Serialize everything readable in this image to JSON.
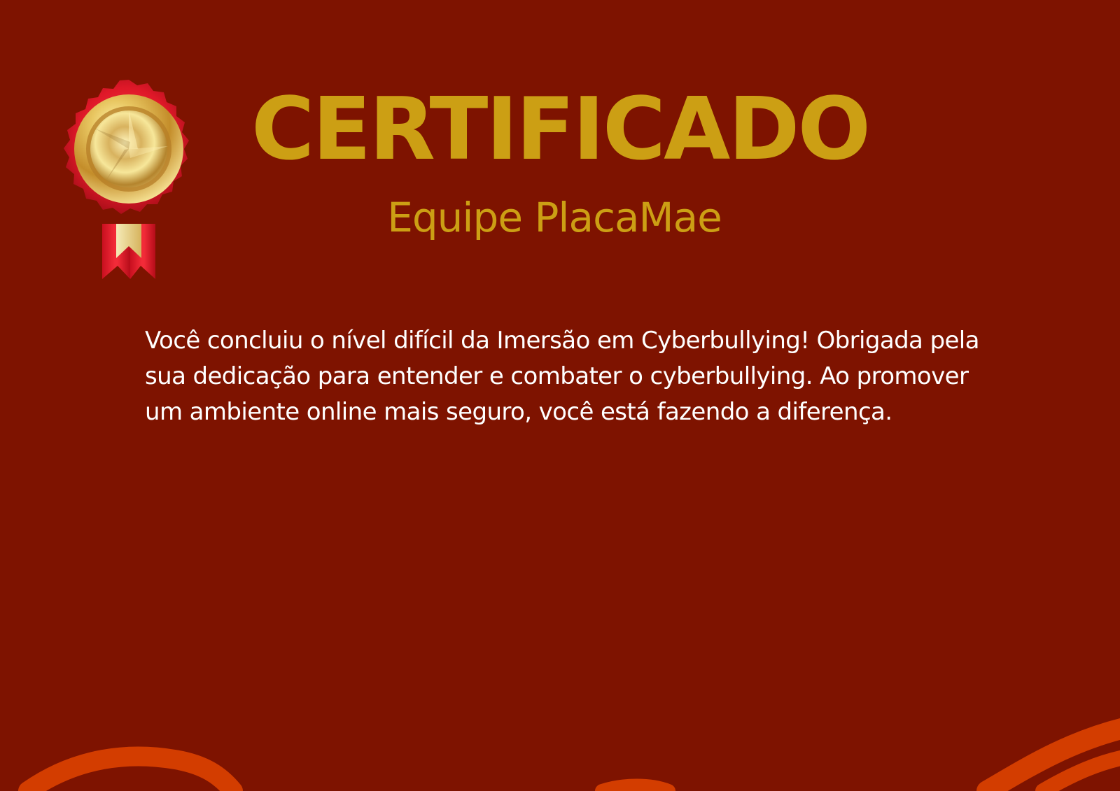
{
  "certificate": {
    "title": "CERTIFICADO",
    "team": "Equipe PlacaMae",
    "message": "Você concluiu  o nível difícil da Imersão em Cyberbullying! Obrigada pela sua dedicação para entender e combater o cyberbullying. Ao promover um ambiente online mais seguro, você está fazendo a diferença.",
    "colors": {
      "background": "#7e1300",
      "gold": "#cc9f14",
      "text": "#ffffff",
      "ribbon_red": "#dd1b2b",
      "wave_orange": "#d33d00"
    },
    "badge_icon": "gold-medal-rosette-icon"
  }
}
